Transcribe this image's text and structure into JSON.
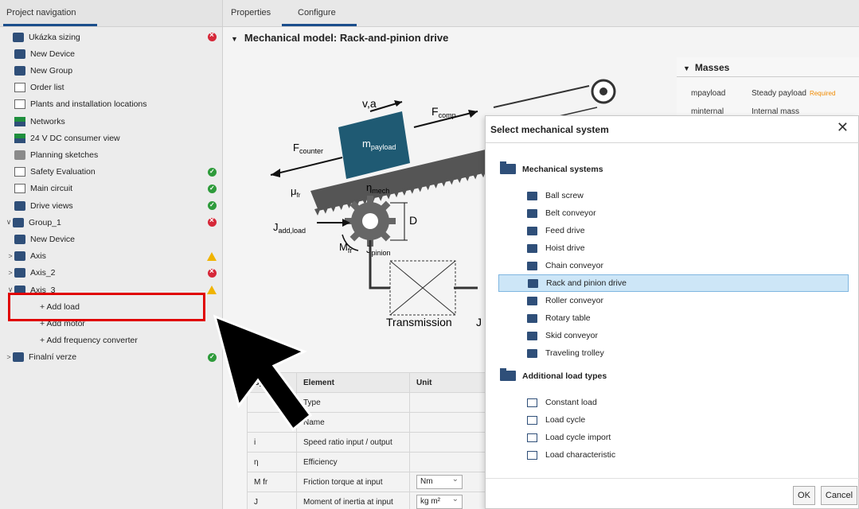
{
  "left_panel": {
    "tab": "Project navigation",
    "tree": [
      {
        "label": "Ukázka sizing",
        "status": "err",
        "chev": "",
        "indent": 0,
        "icon": "project-icon"
      },
      {
        "label": "New Device",
        "status": "",
        "chev": "",
        "indent": 1,
        "icon": "device-icon"
      },
      {
        "label": "New Group",
        "status": "",
        "chev": "",
        "indent": 1,
        "icon": "group-icon"
      },
      {
        "label": "Order list",
        "status": "",
        "chev": "",
        "indent": 1,
        "icon": "cart-icon"
      },
      {
        "label": "Plants and installation locations",
        "status": "",
        "chev": "",
        "indent": 1,
        "icon": "plant-icon"
      },
      {
        "label": "Networks",
        "status": "",
        "chev": "",
        "indent": 1,
        "icon": "network-icon"
      },
      {
        "label": "24 V DC consumer view",
        "status": "",
        "chev": "",
        "indent": 1,
        "icon": "consumer-icon"
      },
      {
        "label": "Planning sketches",
        "status": "",
        "chev": "",
        "indent": 1,
        "icon": "sketch-icon"
      },
      {
        "label": "Safety Evaluation",
        "status": "ok",
        "chev": "",
        "indent": 1,
        "icon": "safety-icon"
      },
      {
        "label": "Main circuit",
        "status": "ok",
        "chev": "",
        "indent": 1,
        "icon": "circuit-icon"
      },
      {
        "label": "Drive views",
        "status": "ok",
        "chev": "",
        "indent": 1,
        "icon": "drive-view-icon"
      },
      {
        "label": "Group_1",
        "status": "err",
        "chev": "∨",
        "indent": 0,
        "icon": "folder-icon"
      },
      {
        "label": "New Device",
        "status": "",
        "chev": "",
        "indent": 1,
        "icon": "device-icon"
      },
      {
        "label": "Axis",
        "status": "warn",
        "chev": ">",
        "indent": 1,
        "icon": "axis-icon"
      },
      {
        "label": "Axis_2",
        "status": "err",
        "chev": ">",
        "indent": 1,
        "icon": "axis-icon"
      },
      {
        "label": "Axis_3",
        "status": "warn",
        "chev": "∨",
        "indent": 1,
        "icon": "axis-icon"
      },
      {
        "label": "+ Add load",
        "status": "",
        "chev": "",
        "indent": 2,
        "icon": ""
      },
      {
        "label": "+ Add motor",
        "status": "",
        "chev": "",
        "indent": 2,
        "icon": ""
      },
      {
        "label": "+ Add frequency converter",
        "status": "",
        "chev": "",
        "indent": 2,
        "icon": ""
      },
      {
        "label": "Finalní verze",
        "status": "ok",
        "chev": ">",
        "indent": 0,
        "icon": "axis-icon"
      }
    ]
  },
  "main": {
    "tabs": [
      "Properties",
      "Configure"
    ],
    "section_title": "Mechanical model: Rack-and-pinion drive",
    "diagram": {
      "labels": {
        "va": "v,a",
        "fcomp": "F",
        "fcomp_sub": "comp",
        "mpayload": "m",
        "mpayload_sub": "payload",
        "fcounter": "F",
        "fcounter_sub": "counter",
        "mufr": "μ",
        "mufr_sub": "fr",
        "nmech": "η",
        "nmech_sub": "mech",
        "d": "D",
        "jadd": "J",
        "jadd_sub": "add,load",
        "mfr": "M",
        "mfr_sub": "fr",
        "jpinion": "J",
        "jpinion_sub": "pinion",
        "transmission": "Transmission",
        "j_right": "J"
      }
    },
    "masses": {
      "title": "Masses",
      "rows": [
        {
          "sym": "mpayload",
          "label": "Steady payload",
          "req": "Required"
        },
        {
          "sym": "minternal",
          "label": "Internal mass",
          "req": ""
        }
      ]
    },
    "transmission": {
      "title": "ssion",
      "headers": [
        "Sy",
        "Element",
        "Unit"
      ],
      "rows": [
        {
          "sym": "",
          "element": "Type",
          "unit": ""
        },
        {
          "sym": "",
          "element": "Name",
          "unit": ""
        },
        {
          "sym": "i",
          "element": "Speed ratio input / output",
          "unit": ""
        },
        {
          "sym": "η",
          "element": "Efficiency",
          "unit": ""
        },
        {
          "sym": "M fr",
          "element": "Friction torque at input",
          "unit": "Nm"
        },
        {
          "sym": "J",
          "element": "Moment of inertia at input",
          "unit": "kg m²"
        }
      ]
    }
  },
  "dialog": {
    "title": "Select mechanical system",
    "close": "✕",
    "groups": [
      {
        "label": "Mechanical systems",
        "items": [
          "Ball screw",
          "Belt conveyor",
          "Feed drive",
          "Hoist drive",
          "Chain conveyor",
          "Rack and pinion drive",
          "Roller conveyor",
          "Rotary table",
          "Skid conveyor",
          "Traveling trolley"
        ]
      },
      {
        "label": "Additional load types",
        "items": [
          "Constant load",
          "Load cycle",
          "Load cycle import",
          "Load characteristic"
        ]
      }
    ],
    "selected": "Rack and pinion drive",
    "ok": "OK",
    "cancel": "Cancel"
  },
  "colors": {
    "accent": "#1b4e8c",
    "selection": "#cde6f7",
    "error": "#d62839",
    "ok": "#2e9b3b",
    "warn": "#f0b400",
    "highlight": "#e00000",
    "payload": "#1f5a73"
  }
}
